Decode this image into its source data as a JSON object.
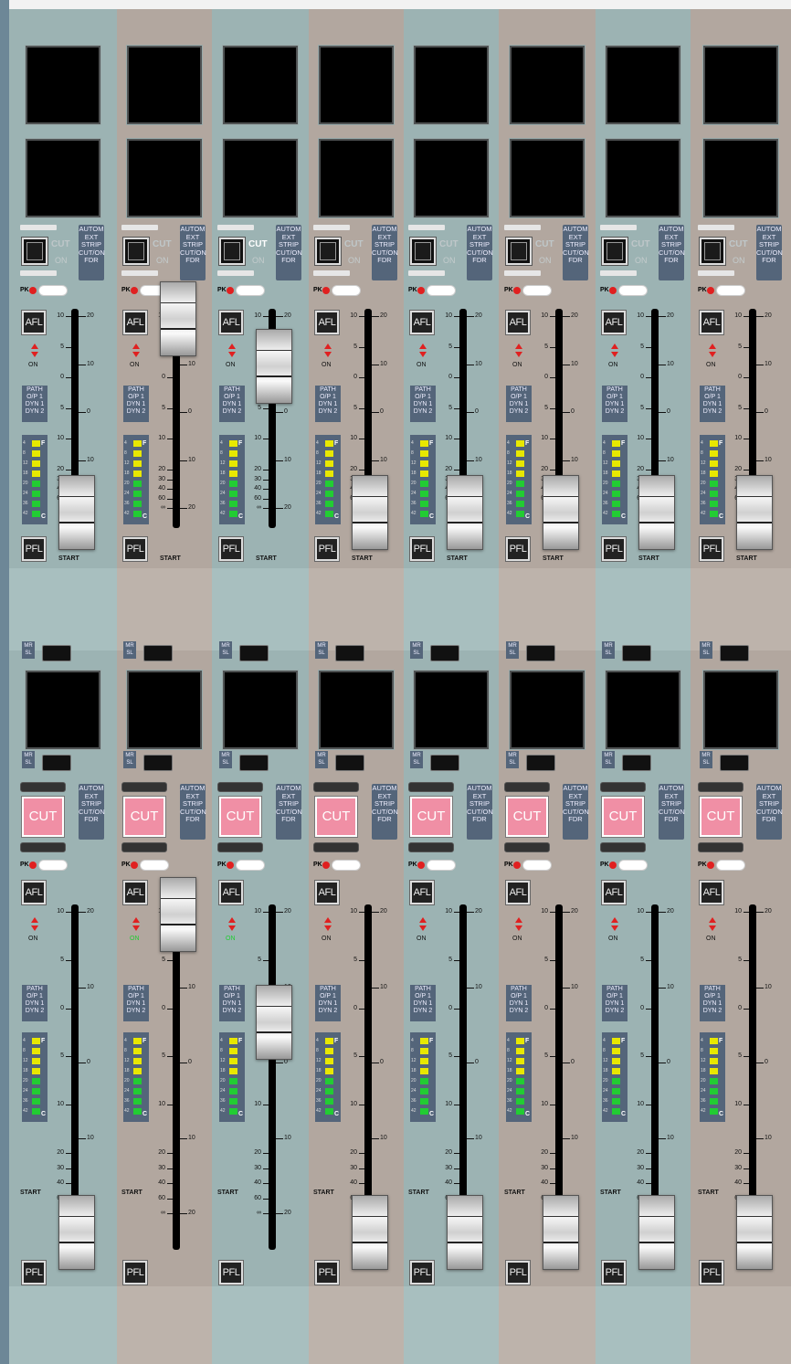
{
  "colors": {
    "teal": "#9cb3b3",
    "tan": "#b2a79f",
    "accent_red": "#e02020",
    "cut_pink": "#f08fa5",
    "meter_bg": "#54657a",
    "led_green": "#22cc33",
    "led_yellow": "#e8e800"
  },
  "labels": {
    "cut": "CUT",
    "on": "ON",
    "autom": "AUTOM",
    "ext": "EXT",
    "strip": "STRIP",
    "cut_on": "CUT/ON",
    "fdr": "FDR",
    "pk": "PK",
    "afl": "AFL",
    "pfl": "PFL",
    "on_small": "ON",
    "start": "START",
    "path": "PATH",
    "op1": "O/P 1",
    "dyn1": "DYN 1",
    "dyn2": "DYN 2",
    "mr": "MR",
    "sl": "SL",
    "big_cut": "CUT",
    "F": "F",
    "C": "C"
  },
  "meter_scale": [
    "4",
    "8",
    "12",
    "18",
    "20",
    "24",
    "36",
    "42"
  ],
  "fader_scale_left": [
    "10",
    "5",
    "0",
    "5",
    "10",
    "20",
    "30",
    "40",
    "60",
    "∞"
  ],
  "fader_scale_right": [
    "20",
    "10",
    "0",
    "10",
    "20"
  ],
  "top_strips": [
    {
      "fader_level": "low",
      "cut_lit": false
    },
    {
      "fader_level": "high",
      "cut_lit": false
    },
    {
      "fader_level": "mid",
      "cut_lit": true
    },
    {
      "fader_level": "low",
      "cut_lit": false
    },
    {
      "fader_level": "low",
      "cut_lit": false
    },
    {
      "fader_level": "low",
      "cut_lit": false
    },
    {
      "fader_level": "low",
      "cut_lit": false
    },
    {
      "fader_level": "low",
      "cut_lit": false
    }
  ],
  "bottom_strips": [
    {
      "fader_level": "low",
      "on_green": false
    },
    {
      "fader_level": "high",
      "on_green": true
    },
    {
      "fader_level": "mid",
      "on_green": true
    },
    {
      "fader_level": "low",
      "on_green": false
    },
    {
      "fader_level": "low",
      "on_green": false
    },
    {
      "fader_level": "low",
      "on_green": false
    },
    {
      "fader_level": "low",
      "on_green": false
    },
    {
      "fader_level": "low",
      "on_green": false
    }
  ]
}
